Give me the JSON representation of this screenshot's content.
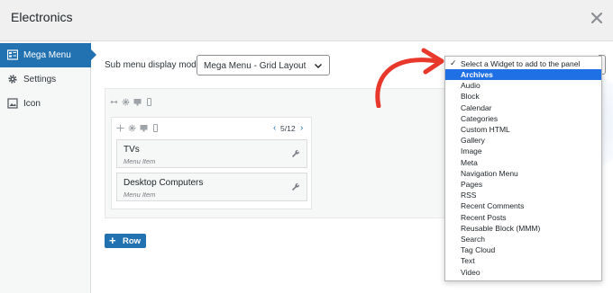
{
  "modal": {
    "title": "Electronics",
    "close_icon": "close-icon"
  },
  "sidebar": {
    "items": [
      {
        "label": "Mega Menu",
        "icon": "grid-menu-icon",
        "active": true
      },
      {
        "label": "Settings",
        "icon": "gear-icon",
        "active": false
      },
      {
        "label": "Icon",
        "icon": "image-icon",
        "active": false
      }
    ]
  },
  "main": {
    "submenu_label": "Sub menu display mode",
    "display_mode": "Mega Menu - Grid Layout",
    "column": {
      "width_label": "5/12",
      "items": [
        {
          "title": "TVs",
          "subtitle": "Menu Item"
        },
        {
          "title": "Desktop Computers",
          "subtitle": "Menu Item"
        }
      ]
    },
    "add_row_label": "Row"
  },
  "widget_dropdown": {
    "placeholder": "Select a Widget to add to the panel",
    "highlighted": "Archives",
    "options": [
      "Archives",
      "Audio",
      "Block",
      "Calendar",
      "Categories",
      "Custom HTML",
      "Gallery",
      "Image",
      "Meta",
      "Navigation Menu",
      "Pages",
      "RSS",
      "Recent Comments",
      "Recent Posts",
      "Reusable Block (MMM)",
      "Search",
      "Tag Cloud",
      "Text",
      "Video"
    ]
  },
  "colors": {
    "accent": "#2271b1",
    "highlight": "#1f6fe5",
    "annotation_arrow": "#e8372b"
  }
}
